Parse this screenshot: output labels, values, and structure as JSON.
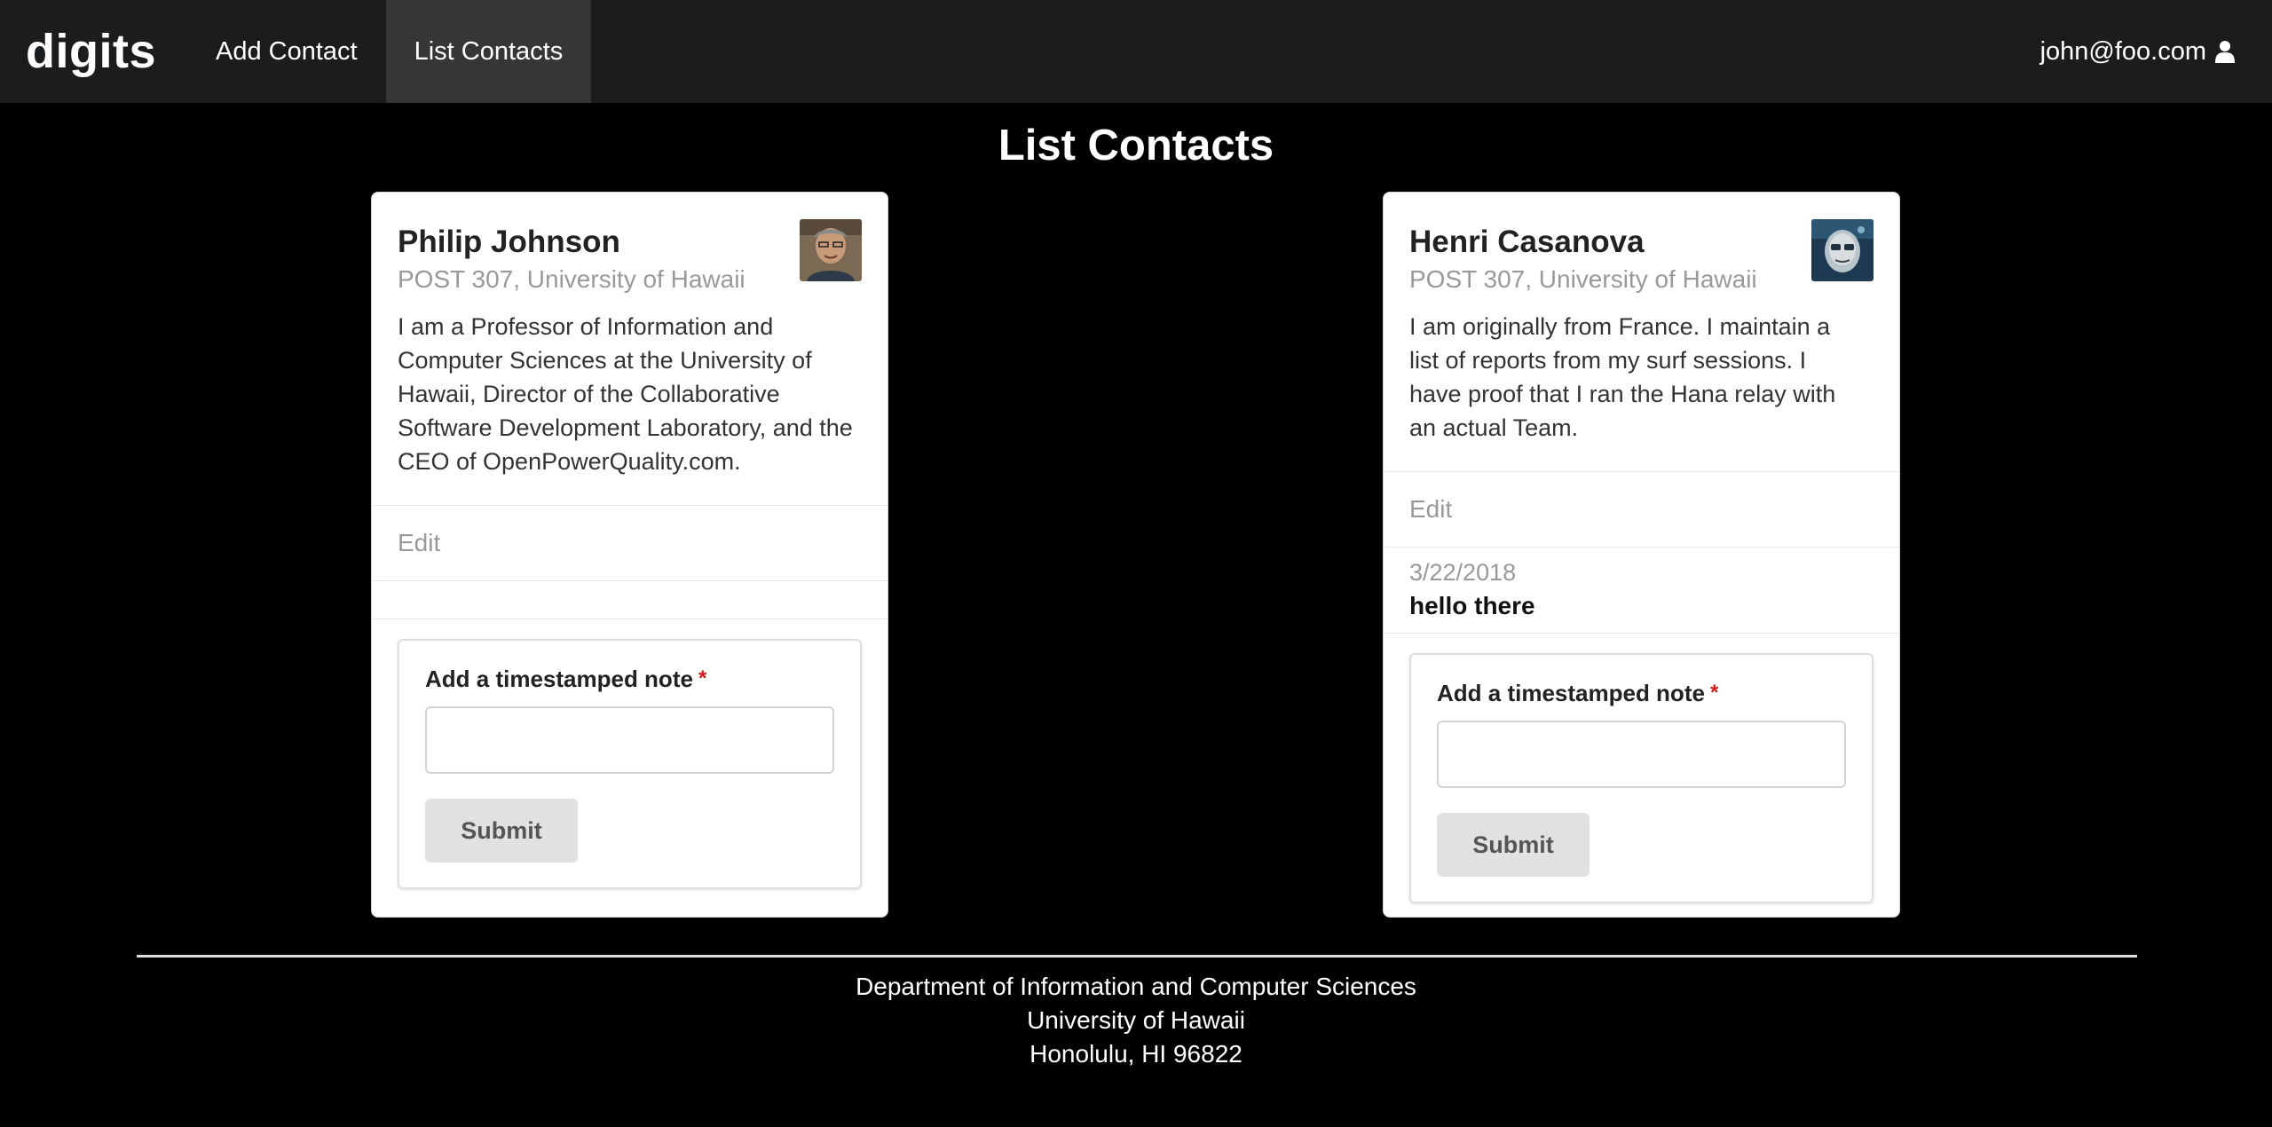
{
  "nav": {
    "brand": "digits",
    "items": [
      {
        "label": "Add Contact"
      },
      {
        "label": "List Contacts"
      }
    ],
    "user": "john@foo.com",
    "user_icon": "user-icon"
  },
  "page": {
    "title": "List Contacts"
  },
  "contacts": [
    {
      "name": "Philip Johnson",
      "address": "POST 307, University of Hawaii",
      "description": "I am a Professor of Information and Computer Sciences at the University of Hawaii, Director of the Collaborative Software Development Laboratory, and the CEO of OpenPowerQuality.com.",
      "edit_label": "Edit",
      "notes": [],
      "form": {
        "label": "Add a timestamped note",
        "required_mark": "*",
        "input_value": "",
        "submit_label": "Submit"
      }
    },
    {
      "name": "Henri Casanova",
      "address": "POST 307, University of Hawaii",
      "description": "I am originally from France. I maintain a list of reports from my surf sessions. I have proof that I ran the Hana relay with an actual Team.",
      "edit_label": "Edit",
      "notes": [
        {
          "date": "3/22/2018",
          "text": "hello there"
        }
      ],
      "form": {
        "label": "Add a timestamped note",
        "required_mark": "*",
        "input_value": "",
        "submit_label": "Submit"
      }
    }
  ],
  "footer": {
    "lines": [
      "Department of Information and Computer Sciences",
      "University of Hawaii",
      "Honolulu, HI 96822"
    ]
  }
}
